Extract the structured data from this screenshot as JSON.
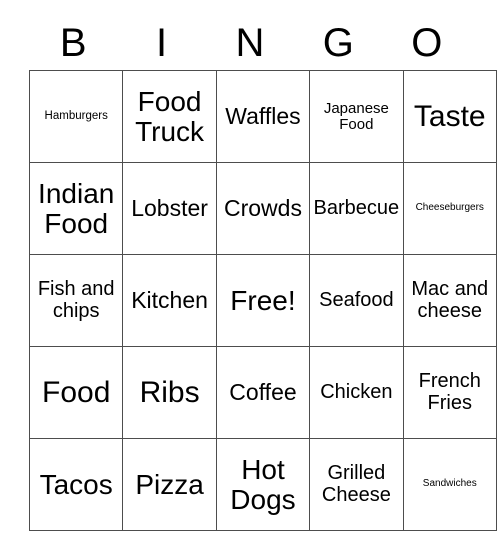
{
  "card": {
    "headers": [
      "B",
      "I",
      "N",
      "G",
      "O"
    ],
    "rows": [
      [
        {
          "text": "Hamburgers",
          "size": "fs-s"
        },
        {
          "text": "Food Truck",
          "size": "fs-xxl"
        },
        {
          "text": "Waffles",
          "size": "fs-xl"
        },
        {
          "text": "Japanese Food",
          "size": "fs-m"
        },
        {
          "text": "Taste",
          "size": "fs-xxxl"
        }
      ],
      [
        {
          "text": "Indian Food",
          "size": "fs-xxl"
        },
        {
          "text": "Lobster",
          "size": "fs-xl"
        },
        {
          "text": "Crowds",
          "size": "fs-xl"
        },
        {
          "text": "Barbecue",
          "size": "fs-l"
        },
        {
          "text": "Cheeseburgers",
          "size": "fs-xs"
        }
      ],
      [
        {
          "text": "Fish and chips",
          "size": "fs-l"
        },
        {
          "text": "Kitchen",
          "size": "fs-xl"
        },
        {
          "text": "Free!",
          "size": "fs-xxl"
        },
        {
          "text": "Seafood",
          "size": "fs-l"
        },
        {
          "text": "Mac and cheese",
          "size": "fs-l"
        }
      ],
      [
        {
          "text": "Food",
          "size": "fs-xxxl"
        },
        {
          "text": "Ribs",
          "size": "fs-xxxl"
        },
        {
          "text": "Coffee",
          "size": "fs-xl"
        },
        {
          "text": "Chicken",
          "size": "fs-l"
        },
        {
          "text": "French Fries",
          "size": "fs-l"
        }
      ],
      [
        {
          "text": "Tacos",
          "size": "fs-xxl"
        },
        {
          "text": "Pizza",
          "size": "fs-xxl"
        },
        {
          "text": "Hot Dogs",
          "size": "fs-xxl"
        },
        {
          "text": "Grilled Cheese",
          "size": "fs-l"
        },
        {
          "text": "Sandwiches",
          "size": "fs-xs"
        }
      ]
    ],
    "free_space": {
      "row": 2,
      "col": 2,
      "label": "Free!"
    },
    "colors": {
      "background": "#ffffff",
      "text": "#000000",
      "grid_line": "#4d4d4d"
    }
  }
}
